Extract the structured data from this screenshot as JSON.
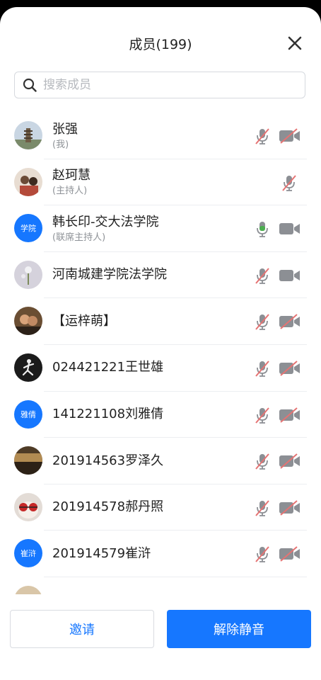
{
  "header": {
    "title": "成员(199)"
  },
  "search": {
    "placeholder": "搜索成员",
    "value": ""
  },
  "colors": {
    "accent": "#1677ff",
    "mic_active": "#4caf50",
    "muted_slash": "#e57373",
    "icon_gray": "#8c8f94"
  },
  "members": [
    {
      "name": "张强",
      "role": "(我)",
      "avatar": {
        "type": "photo",
        "icon": "pagoda-photo"
      },
      "mic": "muted",
      "camera": "off"
    },
    {
      "name": "赵珂慧",
      "role": "(主持人)",
      "avatar": {
        "type": "photo",
        "icon": "people-photo"
      },
      "mic": "muted",
      "camera": "none"
    },
    {
      "name": "韩长印-交大法学院",
      "role": "(联席主持人)",
      "avatar": {
        "type": "text",
        "text": "学院"
      },
      "mic": "active",
      "camera": "on"
    },
    {
      "name": "河南城建学院法学院",
      "role": "",
      "avatar": {
        "type": "photo",
        "icon": "flower-photo"
      },
      "mic": "muted",
      "camera": "on"
    },
    {
      "name": "【运梓萌】",
      "role": "",
      "avatar": {
        "type": "photo",
        "icon": "couple-photo"
      },
      "mic": "muted",
      "camera": "off"
    },
    {
      "name": "024421221王世雄",
      "role": "",
      "avatar": {
        "type": "photo",
        "icon": "runner-photo"
      },
      "mic": "muted",
      "camera": "off"
    },
    {
      "name": "141221108刘雅倩",
      "role": "",
      "avatar": {
        "type": "text",
        "text": "雅倩"
      },
      "mic": "muted",
      "camera": "off"
    },
    {
      "name": "201914563罗泽久",
      "role": "",
      "avatar": {
        "type": "photo",
        "icon": "landscape-photo"
      },
      "mic": "muted",
      "camera": "off"
    },
    {
      "name": "201914578郝丹照",
      "role": "",
      "avatar": {
        "type": "photo",
        "icon": "cat-photo"
      },
      "mic": "muted",
      "camera": "off"
    },
    {
      "name": "201914579崔浒",
      "role": "",
      "avatar": {
        "type": "text",
        "text": "崔浒"
      },
      "mic": "muted",
      "camera": "off"
    }
  ],
  "footer": {
    "invite_label": "邀请",
    "unmute_label": "解除静音"
  }
}
